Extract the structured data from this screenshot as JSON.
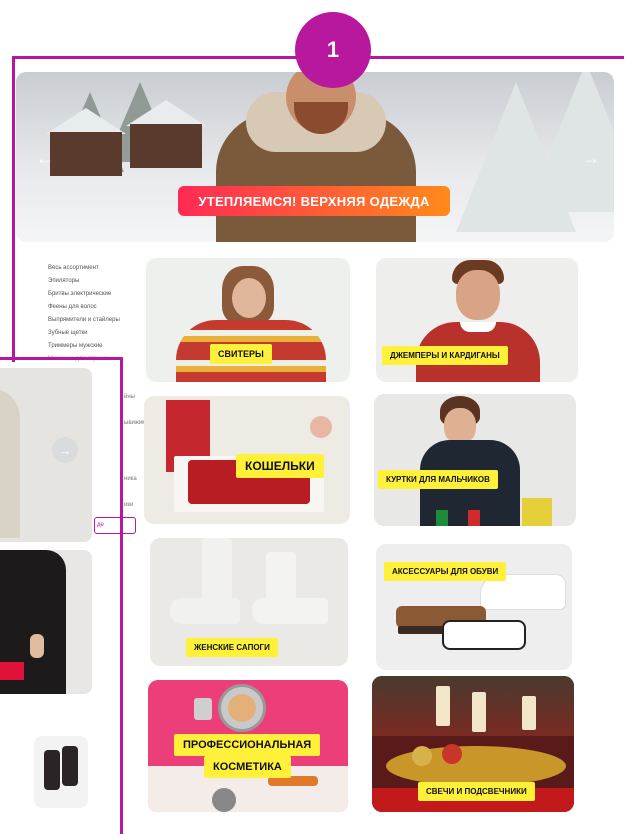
{
  "highlight": {
    "badge": "1",
    "color": "#b5179e"
  },
  "banner": {
    "cta": "УТЕПЛЯЕМСЯ! ВЕРХНЯЯ ОДЕЖДА",
    "prev_icon": "chevron-left-icon",
    "next_icon": "chevron-right-icon"
  },
  "categories": [
    "Весь ассортимент",
    "Эпиляторы",
    "Бритвы электрические",
    "Феены для волос",
    "Выпрямители и стайлеры",
    "Зубные щетки",
    "Триммеры мужские",
    "Машинки для стрижки"
  ],
  "menu_fragments": [
    "йны",
    "ывижимые",
    "ника",
    "ики",
    "де"
  ],
  "tiles": [
    {
      "label": "СВИТЕРЫ"
    },
    {
      "label": "ДЖЕМПЕРЫ И КАРДИГАНЫ"
    },
    {
      "label": "КОШЕЛЬКИ"
    },
    {
      "label": "КУРТКИ ДЛЯ МАЛЬЧИКОВ"
    },
    {
      "label": "ЖЕНСКИЕ САПОГИ"
    },
    {
      "label": "АКСЕССУАРЫ ДЛЯ ОБУВИ"
    },
    {
      "label_line1": "ПРОФЕССИОНАЛЬНАЯ",
      "label_line2": "КОСМЕТИКА"
    },
    {
      "label": "СВЕЧИ И ПОДСВЕЧНИКИ"
    }
  ],
  "overlay": {
    "next_icon": "arrow-right-icon"
  }
}
